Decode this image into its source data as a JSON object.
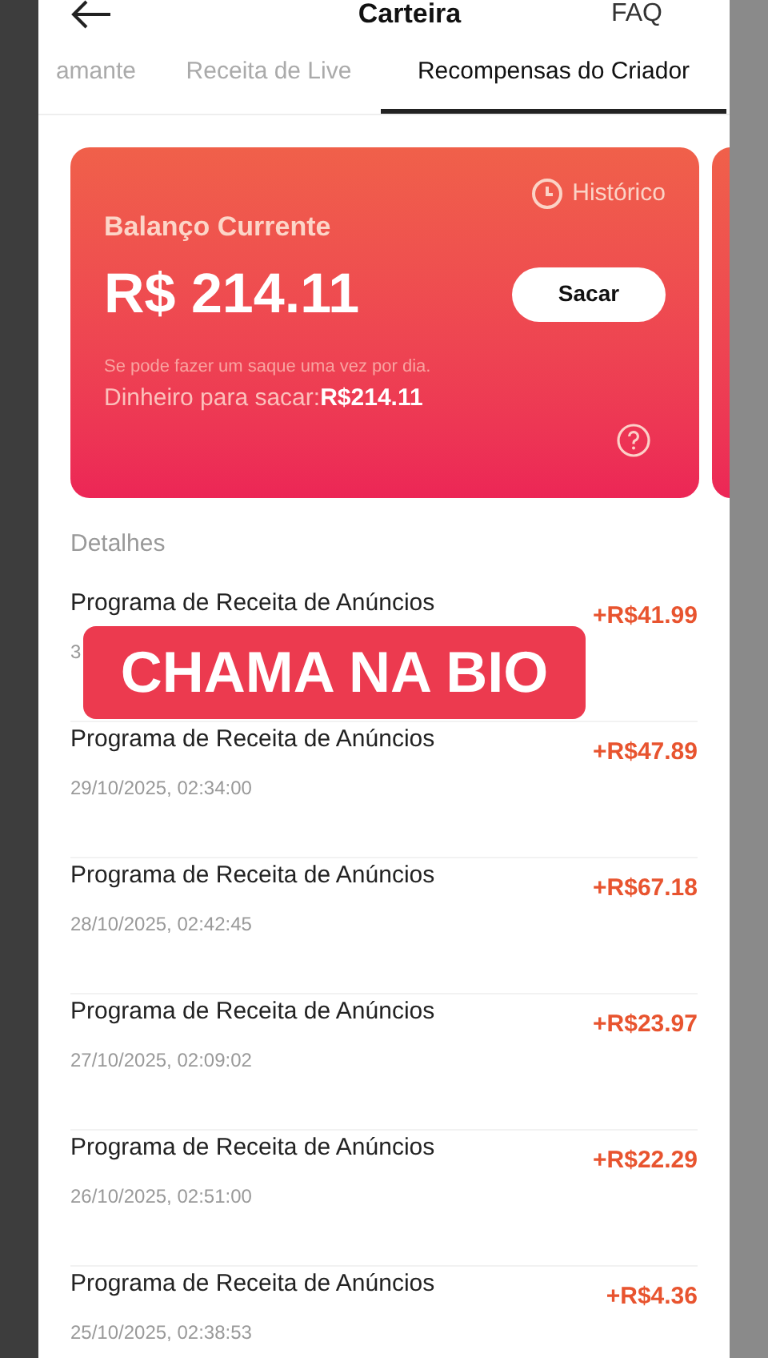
{
  "header": {
    "title": "Carteira",
    "faq": "FAQ"
  },
  "tabs": [
    {
      "label": "amante",
      "selected": false
    },
    {
      "label": "Receita de Live",
      "selected": false
    },
    {
      "label": "Recompensas do Criador",
      "selected": true
    }
  ],
  "balance_card": {
    "history": "Histórico",
    "label": "Balanço Currente",
    "amount": "R$ 214.11",
    "withdraw_button": "Sacar",
    "note": "Se pode fazer um saque uma vez por dia.",
    "available": "Dinheiro para sacar:**R$214.11**"
  },
  "details": {
    "title": "Detalhes",
    "rows": [
      {
        "name": "Programa de Receita de Anúncios",
        "date": "3",
        "amount": "+R$41.99"
      },
      {
        "name": "Programa de Receita de Anúncios",
        "date": "29/10/2025, 02:34:00",
        "amount": "+R$47.89"
      },
      {
        "name": "Programa de Receita de Anúncios",
        "date": "28/10/2025, 02:42:45",
        "amount": "+R$67.18"
      },
      {
        "name": "Programa de Receita de Anúncios",
        "date": "27/10/2025, 02:09:02",
        "amount": "+R$23.97"
      },
      {
        "name": "Programa de Receita de Anúncios",
        "date": "26/10/2025, 02:51:00",
        "amount": "+R$22.29"
      },
      {
        "name": "Programa de Receita de Anúncios",
        "date": "25/10/2025, 02:38:53",
        "amount": "+R$4.36"
      }
    ]
  },
  "overlay_banner": "CHAMA NA BIO"
}
